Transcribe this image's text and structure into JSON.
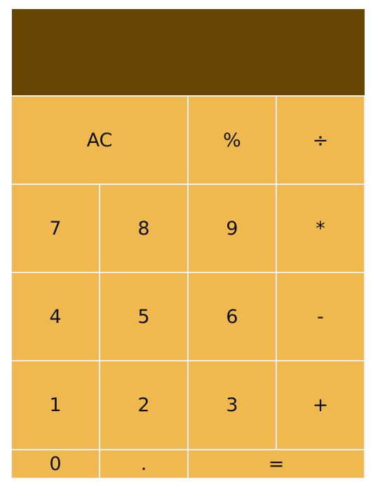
{
  "display": {
    "value": ""
  },
  "keys": {
    "clear": "AC",
    "percent": "%",
    "divide": "÷",
    "seven": "7",
    "eight": "8",
    "nine": "9",
    "multiply": "*",
    "four": "4",
    "five": "5",
    "six": "6",
    "subtract": "-",
    "one": "1",
    "two": "2",
    "three": "3",
    "add": "+",
    "zero": "0",
    "decimal": ".",
    "equals": "="
  },
  "colors": {
    "display_background": "#664403",
    "key_background": "#efb94f",
    "grid_lines": "#efefef",
    "key_text": "#111111"
  }
}
